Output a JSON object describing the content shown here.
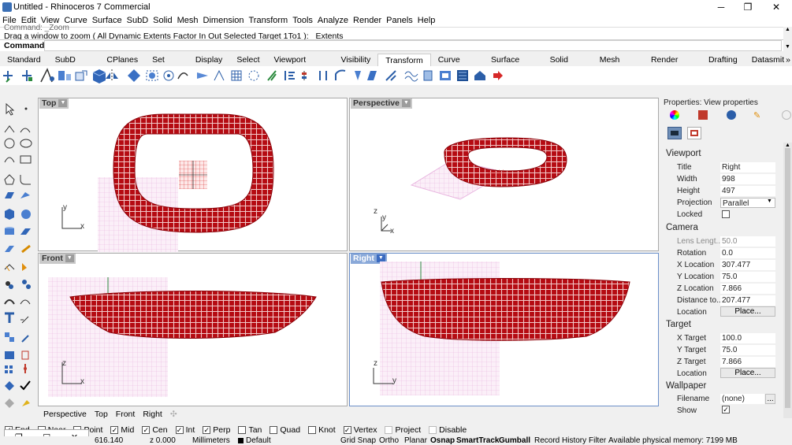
{
  "window": {
    "title": "Untitled - Rhinoceros 7 Commercial",
    "minimize": "─",
    "maximize": "❐",
    "close": "✕"
  },
  "menu": [
    "File",
    "Edit",
    "View",
    "Curve",
    "Surface",
    "SubD",
    "Solid",
    "Mesh",
    "Dimension",
    "Transform",
    "Tools",
    "Analyze",
    "Render",
    "Panels",
    "Help"
  ],
  "command": {
    "history1": "Command: _Zoom",
    "history2": "Drag a window to zoom ( All  Dynamic  Extents  Factor  In  Out  Selected  Target  1To1 ): _Extents",
    "label": "Command:",
    "value": ""
  },
  "tabs": [
    "Standard",
    "SubD Tools",
    "CPlanes",
    "Set View",
    "Display",
    "Select",
    "Viewport Layout",
    "Visibility",
    "Transform",
    "Curve Tools",
    "Surface Tools",
    "Solid Tools",
    "Mesh Tools",
    "Render Tools",
    "Drafting",
    "Datasmit"
  ],
  "tabs_active": "Transform",
  "tabs_more": "»",
  "viewports": {
    "top": {
      "label": "Top",
      "x": "x",
      "y": "y"
    },
    "perspective": {
      "label": "Perspective",
      "x": "x",
      "y": "y",
      "z": "z"
    },
    "front": {
      "label": "Front",
      "x": "x",
      "z": "z"
    },
    "right": {
      "label": "Right",
      "y": "y",
      "z": "z"
    }
  },
  "properties": {
    "title": "Properties: View properties",
    "viewport_header": "Viewport",
    "title_label": "Title",
    "title_value": "Right",
    "width_label": "Width",
    "width_value": "998",
    "height_label": "Height",
    "height_value": "497",
    "projection_label": "Projection",
    "projection_value": "Parallel",
    "locked_label": "Locked",
    "camera_header": "Camera",
    "lens_label": "Lens Lengt...",
    "lens_value": "50.0",
    "rotation_label": "Rotation",
    "rotation_value": "0.0",
    "xloc_label": "X Location",
    "xloc_value": "307.477",
    "yloc_label": "Y Location",
    "yloc_value": "75.0",
    "zloc_label": "Z Location",
    "zloc_value": "7.866",
    "dist_label": "Distance to...",
    "dist_value": "207.477",
    "location_label": "Location",
    "place_label": "Place...",
    "target_header": "Target",
    "xt_label": "X Target",
    "xt_value": "100.0",
    "yt_label": "Y Target",
    "yt_value": "75.0",
    "zt_label": "Z Target",
    "zt_value": "7.866",
    "tloc_label": "Location",
    "tplace_label": "Place...",
    "wallpaper_header": "Wallpaper",
    "file_label": "Filename",
    "file_value": "(none)",
    "file_btn": "...",
    "show_label": "Show"
  },
  "viewport_tabs": [
    "Perspective",
    "Top",
    "Front",
    "Right"
  ],
  "viewport_tabs_add": "✣",
  "osnaps": [
    {
      "label": "End",
      "checked": true
    },
    {
      "label": "Near",
      "checked": false
    },
    {
      "label": "Point",
      "checked": false
    },
    {
      "label": "Mid",
      "checked": true
    },
    {
      "label": "Cen",
      "checked": true
    },
    {
      "label": "Int",
      "checked": true
    },
    {
      "label": "Perp",
      "checked": true
    },
    {
      "label": "Tan",
      "checked": false
    },
    {
      "label": "Quad",
      "checked": false
    },
    {
      "label": "Knot",
      "checked": false
    },
    {
      "label": "Vertex",
      "checked": true
    },
    {
      "label": "Project",
      "checked": false
    },
    {
      "label": "Disable",
      "checked": false
    }
  ],
  "status": {
    "x": "616.140",
    "y": "z 0.000",
    "units": "Millimeters",
    "layer": "Default",
    "gridsnap": "Grid Snap",
    "ortho": "Ortho",
    "planar": "Planar",
    "osnap": "Osnap",
    "smarttrack": "SmartTrack",
    "gumball": "Gumball",
    "history": "Record History",
    "filter": "Filter",
    "memory": "Available physical memory: 7199 MB"
  },
  "colors": {
    "object": "#b50b12",
    "grid": "#e8b4df",
    "active_label": "#8aa9d9"
  }
}
